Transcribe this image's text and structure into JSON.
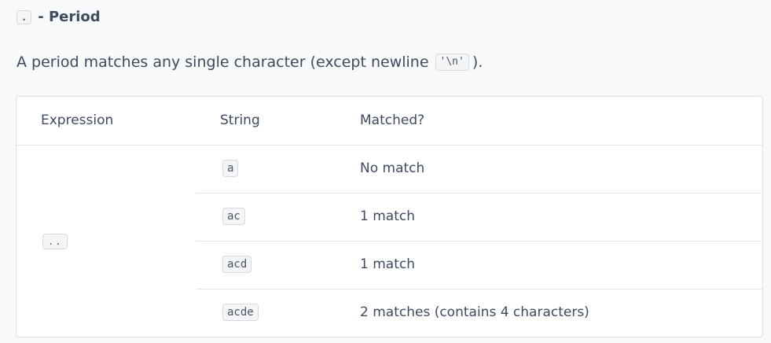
{
  "section": {
    "code": ".",
    "title": "- Period",
    "description_before": "A period matches any single character (except newline",
    "description_code": "'\\n'",
    "description_after": ")."
  },
  "table": {
    "headers": [
      "Expression",
      "String",
      "Matched?"
    ],
    "expression": "..",
    "rows": [
      {
        "string": "a",
        "matched": "No match"
      },
      {
        "string": "ac",
        "matched": "1 match"
      },
      {
        "string": "acd",
        "matched": "1 match"
      },
      {
        "string": "acde",
        "matched": "2 matches (contains 4 characters)"
      }
    ]
  }
}
